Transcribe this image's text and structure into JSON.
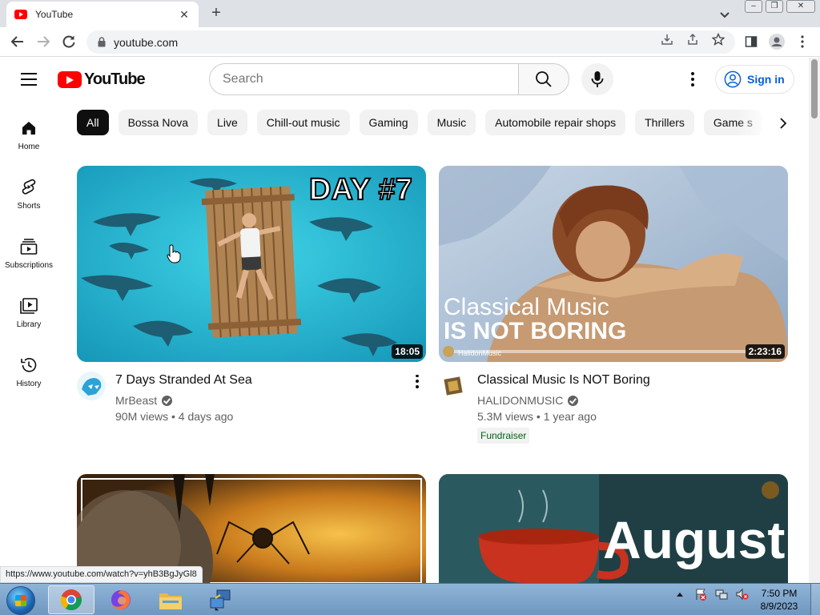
{
  "browser": {
    "tab_title": "YouTube",
    "url": "youtube.com",
    "status_url": "https://www.youtube.com/watch?v=yhB3BgJyGl8"
  },
  "masthead": {
    "logo_text": "YouTube",
    "search_placeholder": "Search",
    "signin_label": "Sign in"
  },
  "guide": {
    "items": [
      {
        "label": "Home",
        "icon": "home-icon"
      },
      {
        "label": "Shorts",
        "icon": "shorts-icon"
      },
      {
        "label": "Subscriptions",
        "icon": "subscriptions-icon"
      },
      {
        "label": "Library",
        "icon": "library-icon"
      },
      {
        "label": "History",
        "icon": "history-icon"
      }
    ]
  },
  "chips": [
    "All",
    "Bossa Nova",
    "Live",
    "Chill-out music",
    "Gaming",
    "Music",
    "Automobile repair shops",
    "Thrillers",
    "Game s"
  ],
  "videos": [
    {
      "title": "7 Days Stranded At Sea",
      "channel": "MrBeast",
      "meta": "90M views • 4 days ago",
      "duration": "18:05",
      "thumb_text": "DAY #7"
    },
    {
      "title": "Classical Music Is NOT Boring",
      "channel": "HALIDONMUSIC",
      "meta": "5.3M views • 1 year ago",
      "duration": "2:23:16",
      "badge": "Fundraiser",
      "thumb_line1": "Classical Music",
      "thumb_line2": "IS NOT BORING",
      "thumb_watermark": "HalidonMusic"
    },
    {
      "title": "",
      "channel": ""
    },
    {
      "title": "",
      "channel": "",
      "thumb_text": "August"
    }
  ],
  "taskbar": {
    "time": "7:50 PM",
    "date": "8/9/2023"
  }
}
